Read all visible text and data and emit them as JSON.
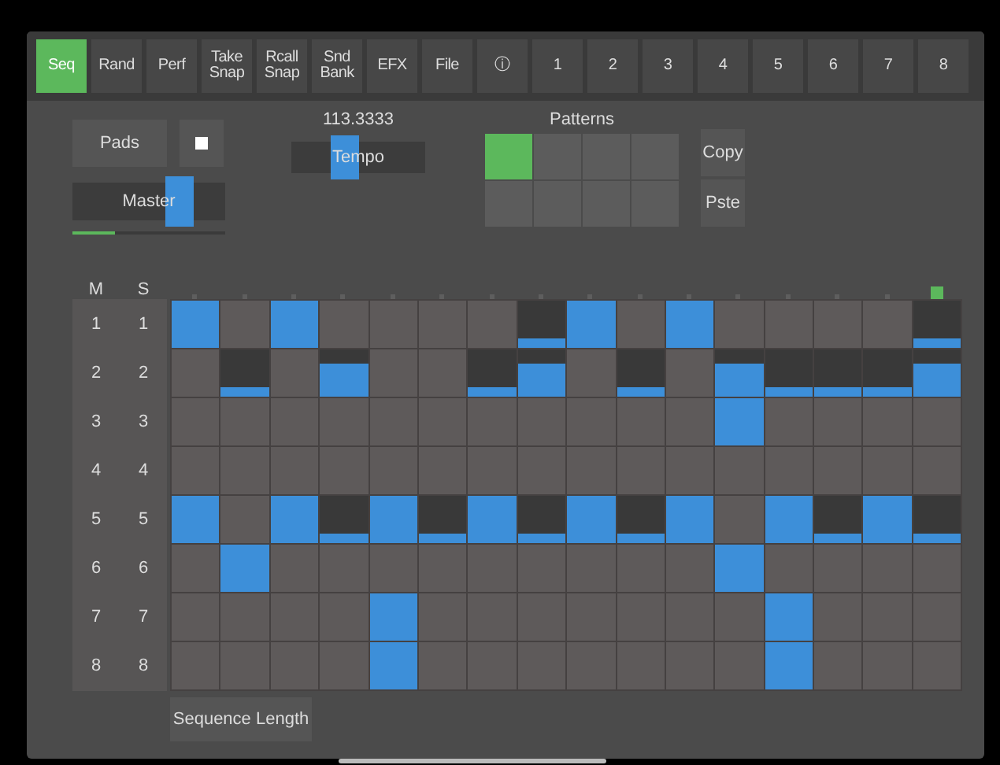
{
  "tabs": [
    {
      "label": "Seq",
      "selected": true
    },
    {
      "label": "Rand",
      "selected": false
    },
    {
      "label": "Perf",
      "selected": false
    },
    {
      "label": "Take Snap",
      "selected": false
    },
    {
      "label": "Rcall Snap",
      "selected": false
    },
    {
      "label": "Snd Bank",
      "selected": false
    },
    {
      "label": "EFX",
      "selected": false
    },
    {
      "label": "File",
      "selected": false
    },
    {
      "label": "ⓘ",
      "selected": false
    },
    {
      "label": "1",
      "selected": false
    },
    {
      "label": "2",
      "selected": false
    },
    {
      "label": "3",
      "selected": false
    },
    {
      "label": "4",
      "selected": false
    },
    {
      "label": "5",
      "selected": false
    },
    {
      "label": "6",
      "selected": false
    },
    {
      "label": "7",
      "selected": false
    },
    {
      "label": "8",
      "selected": false
    }
  ],
  "controls": {
    "pads_button": "Pads",
    "master": {
      "label": "Master",
      "level": 0.75
    },
    "master_meter": {
      "level": 0.28
    },
    "tempo": {
      "value": "113.3333",
      "label": "Tempo",
      "level": 0.37
    }
  },
  "patterns": {
    "title": "Patterns",
    "slots": [
      {
        "selected": true
      },
      {
        "selected": false
      },
      {
        "selected": false
      },
      {
        "selected": false
      },
      {
        "selected": false
      },
      {
        "selected": false
      },
      {
        "selected": false
      },
      {
        "selected": false
      }
    ],
    "buttons": [
      "Copy",
      "Pste"
    ]
  },
  "grid": {
    "headers": [
      "M",
      "S"
    ],
    "step_lights": [
      {
        "selected": false
      },
      {
        "selected": false
      },
      {
        "selected": false
      },
      {
        "selected": false
      },
      {
        "selected": false
      },
      {
        "selected": false
      },
      {
        "selected": false
      },
      {
        "selected": false
      },
      {
        "selected": false
      },
      {
        "selected": false
      },
      {
        "selected": false
      },
      {
        "selected": false
      },
      {
        "selected": false
      },
      {
        "selected": false
      },
      {
        "selected": false
      },
      {
        "selected": true
      }
    ],
    "rows": [
      {
        "m": "1",
        "s": "1",
        "steps": [
          {
            "kind": "full"
          },
          {
            "kind": "empty"
          },
          {
            "kind": "full"
          },
          {
            "kind": "empty"
          },
          {
            "kind": "empty"
          },
          {
            "kind": "empty"
          },
          {
            "kind": "empty"
          },
          {
            "kind": "low"
          },
          {
            "kind": "full"
          },
          {
            "kind": "empty"
          },
          {
            "kind": "full"
          },
          {
            "kind": "empty"
          },
          {
            "kind": "empty"
          },
          {
            "kind": "empty"
          },
          {
            "kind": "empty"
          },
          {
            "kind": "low"
          }
        ]
      },
      {
        "m": "2",
        "s": "2",
        "steps": [
          {
            "kind": "empty"
          },
          {
            "kind": "low"
          },
          {
            "kind": "empty"
          },
          {
            "kind": "high"
          },
          {
            "kind": "empty"
          },
          {
            "kind": "empty"
          },
          {
            "kind": "low"
          },
          {
            "kind": "high"
          },
          {
            "kind": "empty"
          },
          {
            "kind": "low"
          },
          {
            "kind": "empty"
          },
          {
            "kind": "high"
          },
          {
            "kind": "low"
          },
          {
            "kind": "low"
          },
          {
            "kind": "low"
          },
          {
            "kind": "high"
          }
        ]
      },
      {
        "m": "3",
        "s": "3",
        "steps": [
          {
            "kind": "empty"
          },
          {
            "kind": "empty"
          },
          {
            "kind": "empty"
          },
          {
            "kind": "empty"
          },
          {
            "kind": "empty"
          },
          {
            "kind": "empty"
          },
          {
            "kind": "empty"
          },
          {
            "kind": "empty"
          },
          {
            "kind": "empty"
          },
          {
            "kind": "empty"
          },
          {
            "kind": "empty"
          },
          {
            "kind": "full"
          },
          {
            "kind": "empty"
          },
          {
            "kind": "empty"
          },
          {
            "kind": "empty"
          },
          {
            "kind": "empty"
          }
        ]
      },
      {
        "m": "4",
        "s": "4",
        "steps": [
          {
            "kind": "empty"
          },
          {
            "kind": "empty"
          },
          {
            "kind": "empty"
          },
          {
            "kind": "empty"
          },
          {
            "kind": "empty"
          },
          {
            "kind": "empty"
          },
          {
            "kind": "empty"
          },
          {
            "kind": "empty"
          },
          {
            "kind": "empty"
          },
          {
            "kind": "empty"
          },
          {
            "kind": "empty"
          },
          {
            "kind": "empty"
          },
          {
            "kind": "empty"
          },
          {
            "kind": "empty"
          },
          {
            "kind": "empty"
          },
          {
            "kind": "empty"
          }
        ]
      },
      {
        "m": "5",
        "s": "5",
        "steps": [
          {
            "kind": "full"
          },
          {
            "kind": "empty"
          },
          {
            "kind": "full"
          },
          {
            "kind": "low"
          },
          {
            "kind": "full"
          },
          {
            "kind": "low"
          },
          {
            "kind": "full"
          },
          {
            "kind": "low"
          },
          {
            "kind": "full"
          },
          {
            "kind": "low"
          },
          {
            "kind": "full"
          },
          {
            "kind": "empty"
          },
          {
            "kind": "full"
          },
          {
            "kind": "low"
          },
          {
            "kind": "full"
          },
          {
            "kind": "low"
          }
        ]
      },
      {
        "m": "6",
        "s": "6",
        "steps": [
          {
            "kind": "empty"
          },
          {
            "kind": "full"
          },
          {
            "kind": "empty"
          },
          {
            "kind": "empty"
          },
          {
            "kind": "empty"
          },
          {
            "kind": "empty"
          },
          {
            "kind": "empty"
          },
          {
            "kind": "empty"
          },
          {
            "kind": "empty"
          },
          {
            "kind": "empty"
          },
          {
            "kind": "empty"
          },
          {
            "kind": "full"
          },
          {
            "kind": "empty"
          },
          {
            "kind": "empty"
          },
          {
            "kind": "empty"
          },
          {
            "kind": "empty"
          }
        ]
      },
      {
        "m": "7",
        "s": "7",
        "steps": [
          {
            "kind": "empty"
          },
          {
            "kind": "empty"
          },
          {
            "kind": "empty"
          },
          {
            "kind": "empty"
          },
          {
            "kind": "full"
          },
          {
            "kind": "empty"
          },
          {
            "kind": "empty"
          },
          {
            "kind": "empty"
          },
          {
            "kind": "empty"
          },
          {
            "kind": "empty"
          },
          {
            "kind": "empty"
          },
          {
            "kind": "empty"
          },
          {
            "kind": "full"
          },
          {
            "kind": "empty"
          },
          {
            "kind": "empty"
          },
          {
            "kind": "empty"
          }
        ]
      },
      {
        "m": "8",
        "s": "8",
        "steps": [
          {
            "kind": "empty"
          },
          {
            "kind": "empty"
          },
          {
            "kind": "empty"
          },
          {
            "kind": "empty"
          },
          {
            "kind": "full"
          },
          {
            "kind": "empty"
          },
          {
            "kind": "empty"
          },
          {
            "kind": "empty"
          },
          {
            "kind": "empty"
          },
          {
            "kind": "empty"
          },
          {
            "kind": "empty"
          },
          {
            "kind": "empty"
          },
          {
            "kind": "full"
          },
          {
            "kind": "empty"
          },
          {
            "kind": "empty"
          },
          {
            "kind": "empty"
          }
        ]
      }
    ],
    "length_button": "Sequence Length"
  }
}
